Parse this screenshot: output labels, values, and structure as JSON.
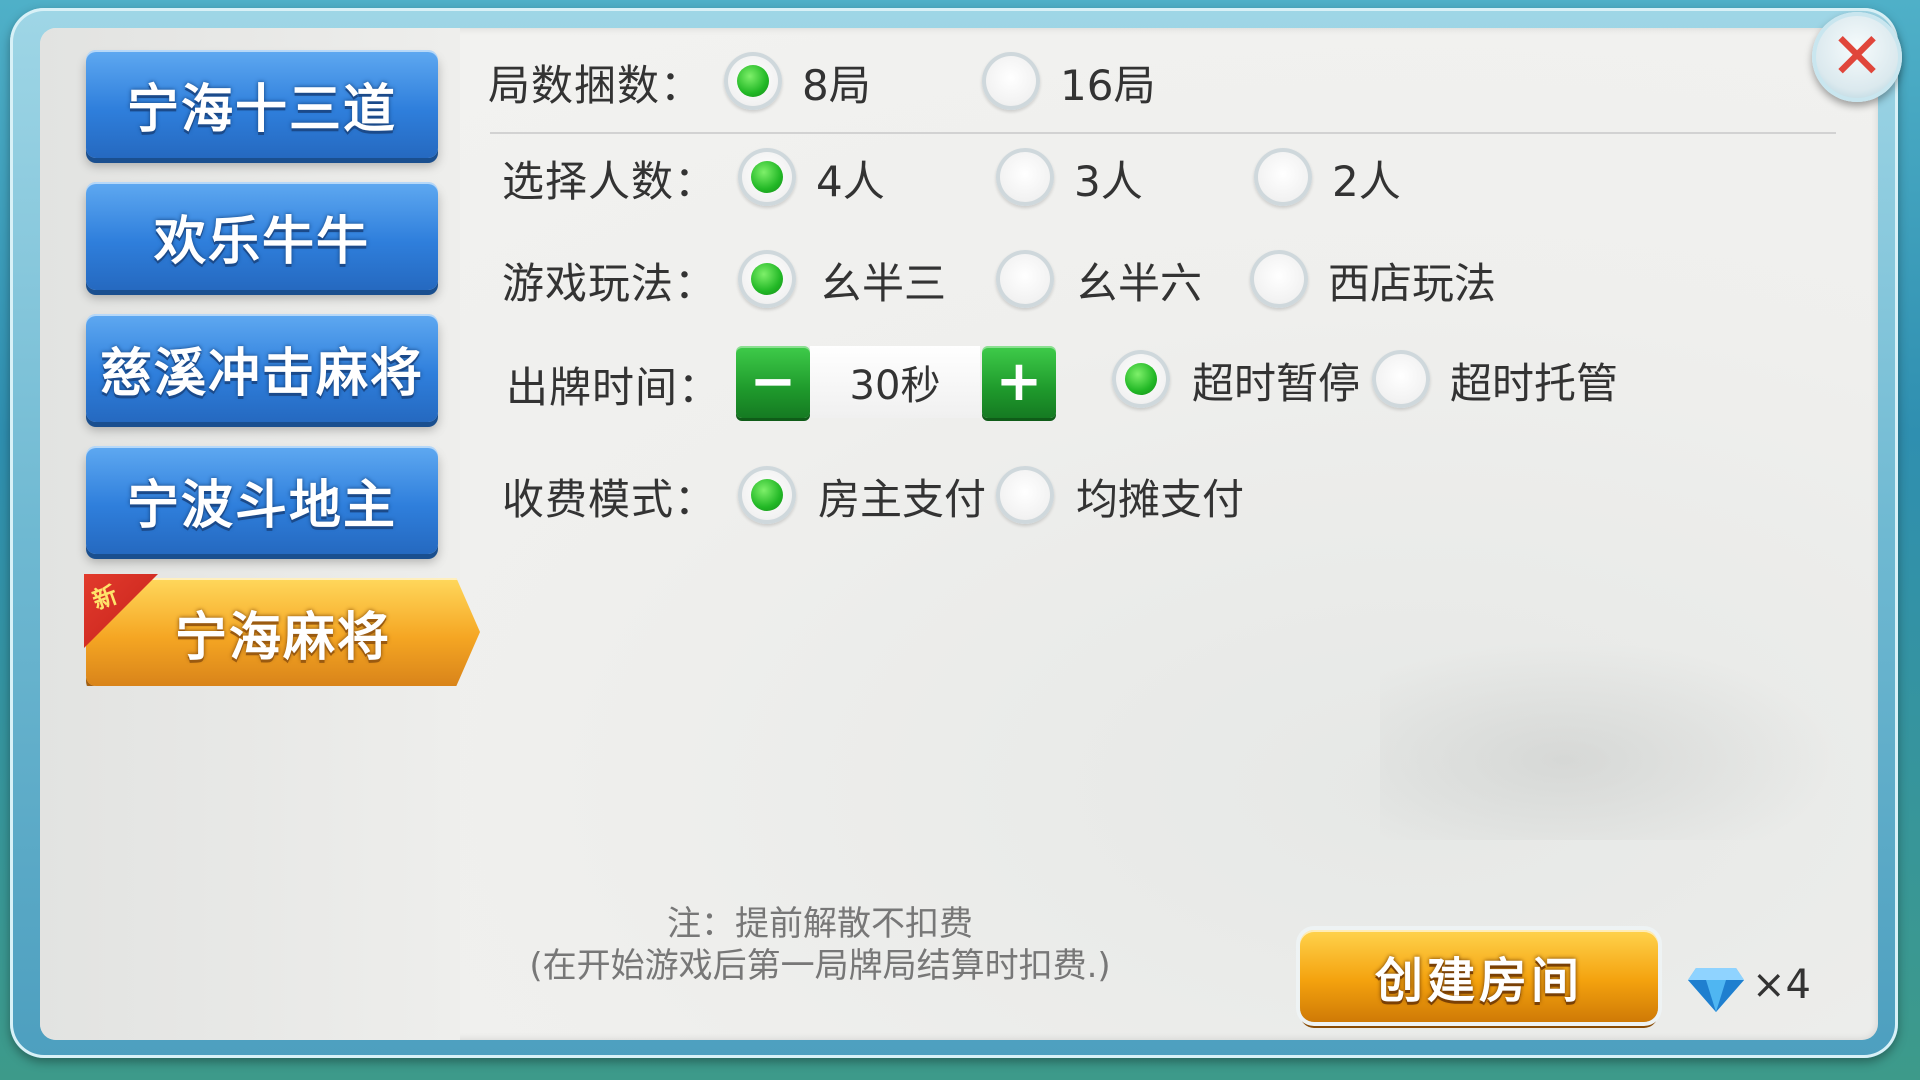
{
  "sidebar": {
    "tabs": [
      {
        "label": "宁海十三道"
      },
      {
        "label": "欢乐牛牛"
      },
      {
        "label": "慈溪冲击麻将"
      },
      {
        "label": "宁波斗地主"
      },
      {
        "label": "宁海麻将",
        "badge": "新",
        "active": true
      }
    ]
  },
  "close": {
    "icon": "close-icon"
  },
  "settings": {
    "rounds": {
      "label": "局数捆数：",
      "options": [
        "8局",
        "16局"
      ],
      "selected": "8局"
    },
    "players": {
      "label": "选择人数：",
      "options": [
        "4人",
        "3人",
        "2人"
      ],
      "selected": "4人"
    },
    "mode": {
      "label": "游戏玩法：",
      "options": [
        "幺半三",
        "幺半六",
        "西店玩法"
      ],
      "selected": "幺半三"
    },
    "time": {
      "label": "出牌时间：",
      "value": "30秒",
      "minus": "−",
      "plus": "+",
      "options": [
        "超时暂停",
        "超时托管"
      ],
      "selected": "超时暂停"
    },
    "fee": {
      "label": "收费模式：",
      "options": [
        "房主支付",
        "均摊支付"
      ],
      "selected": "房主支付"
    }
  },
  "note": {
    "line1": "注：提前解散不扣费",
    "line2": "(在开始游戏后第一局牌局结算时扣费.)"
  },
  "create_button": {
    "label": "创建房间"
  },
  "cost": {
    "icon": "diamond-icon",
    "count": "×4"
  },
  "colors": {
    "accent_green": "#22b826",
    "tab_blue": "#2f7fdc",
    "tab_gold": "#f5a623",
    "close_red": "#e0463b"
  }
}
